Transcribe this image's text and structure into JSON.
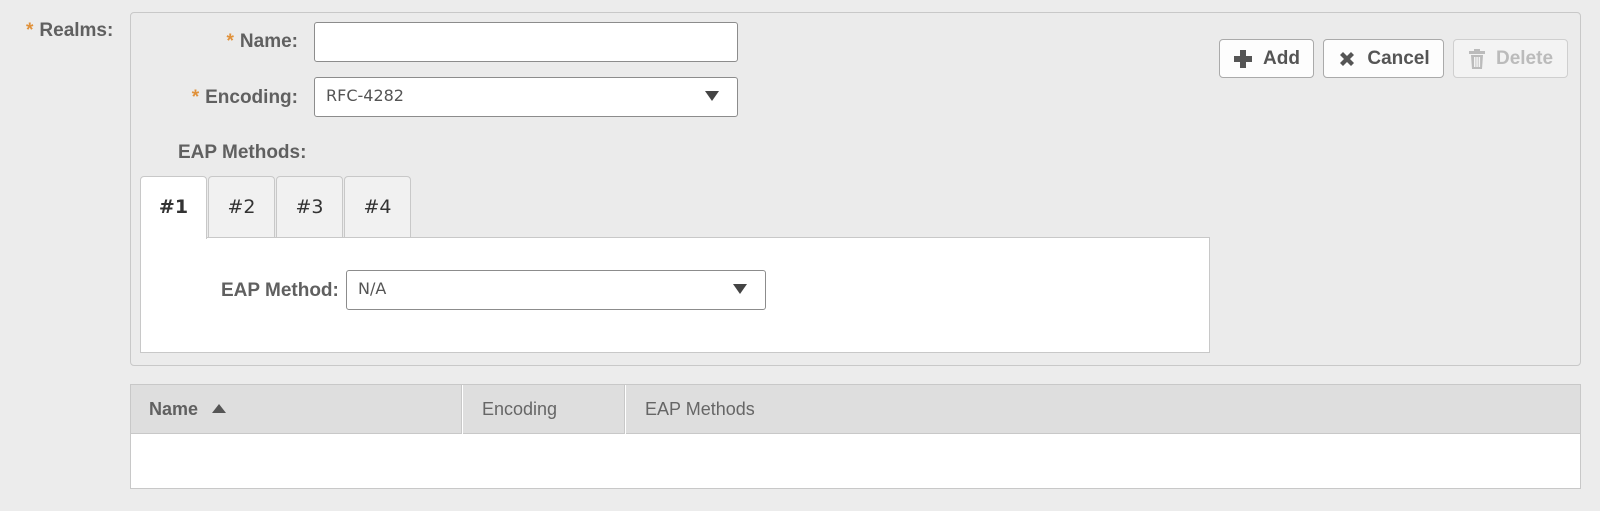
{
  "realms": {
    "label": "Realms:",
    "required_mark": "*"
  },
  "form": {
    "name": {
      "label": "Name:",
      "required_mark": "*",
      "value": ""
    },
    "encoding": {
      "label": "Encoding:",
      "required_mark": "*",
      "value": "RFC-4282"
    },
    "eap_methods_label": "EAP Methods:",
    "tabs": [
      {
        "label": "#1",
        "active": true
      },
      {
        "label": "#2",
        "active": false
      },
      {
        "label": "#3",
        "active": false
      },
      {
        "label": "#4",
        "active": false
      }
    ],
    "eap_method": {
      "label": "EAP Method:",
      "value": "N/A"
    }
  },
  "toolbar": {
    "add_label": "Add",
    "cancel_label": "Cancel",
    "delete_label": "Delete",
    "add_icon": "plus-icon",
    "cancel_icon": "x-icon",
    "delete_icon": "trash-icon"
  },
  "table": {
    "columns": [
      {
        "label": "Name",
        "sorted": "asc"
      },
      {
        "label": "Encoding"
      },
      {
        "label": "EAP Methods"
      }
    ],
    "rows": []
  },
  "colors": {
    "required": "#e0913a",
    "background": "#ececec",
    "header_bg": "#dedede"
  }
}
